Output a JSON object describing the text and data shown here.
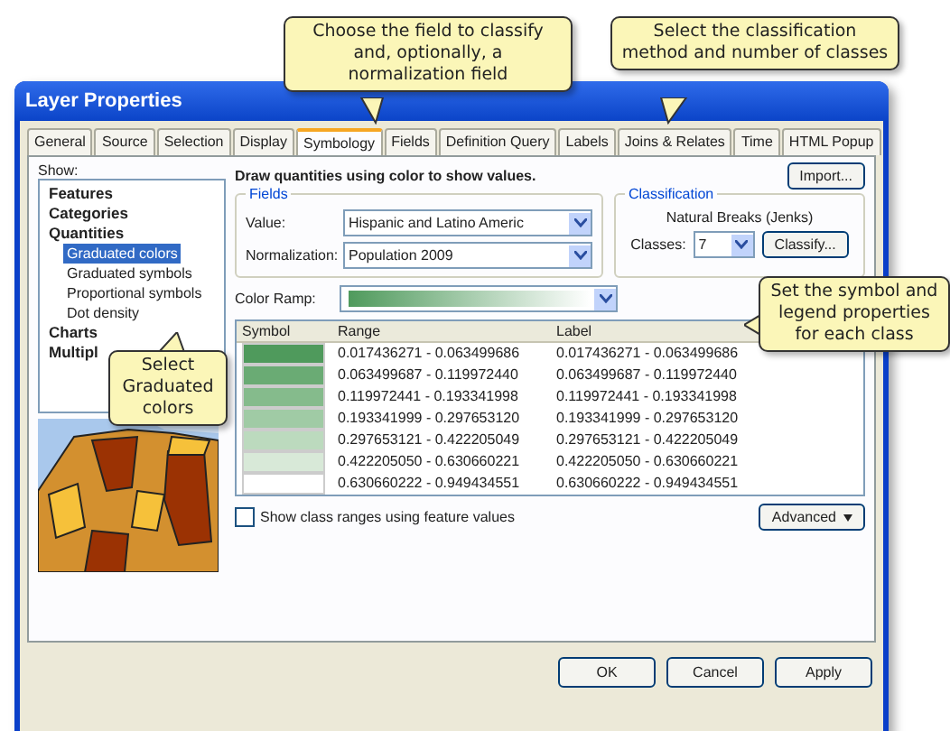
{
  "window": {
    "title": "Layer Properties"
  },
  "tabs": [
    {
      "label": "General",
      "selected": false
    },
    {
      "label": "Source",
      "selected": false
    },
    {
      "label": "Selection",
      "selected": false
    },
    {
      "label": "Display",
      "selected": false
    },
    {
      "label": "Symbology",
      "selected": true
    },
    {
      "label": "Fields",
      "selected": false
    },
    {
      "label": "Definition Query",
      "selected": false
    },
    {
      "label": "Labels",
      "selected": false
    },
    {
      "label": "Joins & Relates",
      "selected": false
    },
    {
      "label": "Time",
      "selected": false
    },
    {
      "label": "HTML Popup",
      "selected": false
    }
  ],
  "show": {
    "label": "Show:",
    "items": [
      {
        "label": "Features",
        "selected": false
      },
      {
        "label": "Categories",
        "selected": false
      },
      {
        "label": "Quantities",
        "selected": false,
        "children": [
          {
            "label": "Graduated colors",
            "selected": true
          },
          {
            "label": "Graduated symbols",
            "selected": false
          },
          {
            "label": "Proportional symbols",
            "selected": false
          },
          {
            "label": "Dot density",
            "selected": false
          }
        ]
      },
      {
        "label": "Charts",
        "selected": false
      },
      {
        "label": "Multipl",
        "selected": false
      }
    ]
  },
  "preview": {
    "kind": "picture"
  },
  "heading": "Draw quantities using color to show values.",
  "import_button": "Import...",
  "fields": {
    "legend": "Fields",
    "value_label": "Value:",
    "value": "Hispanic and Latino Americ",
    "normalization_label": "Normalization:",
    "normalization": "Population 2009"
  },
  "classification": {
    "legend": "Classification",
    "method": "Natural Breaks (Jenks)",
    "classes_label": "Classes:",
    "classes": "7",
    "classify_button": "Classify..."
  },
  "color_ramp": {
    "label": "Color Ramp:"
  },
  "table": {
    "columns": [
      "Symbol",
      "Range",
      "Label"
    ],
    "rows": [
      {
        "color": "#4f9a5c",
        "range": "0.017436271 - 0.063499686",
        "label": "0.017436271 - 0.063499686"
      },
      {
        "color": "#6aab74",
        "range": "0.063499687 - 0.119972440",
        "label": "0.063499687 - 0.119972440"
      },
      {
        "color": "#85bb8c",
        "range": "0.119972441 - 0.193341998",
        "label": "0.119972441 - 0.193341998"
      },
      {
        "color": "#a0cba5",
        "range": "0.193341999 - 0.297653120",
        "label": "0.193341999 - 0.297653120"
      },
      {
        "color": "#bcdabe",
        "range": "0.297653121 - 0.422205049",
        "label": "0.297653121 - 0.422205049"
      },
      {
        "color": "#d8e9d8",
        "range": "0.422205050 - 0.630660221",
        "label": "0.422205050 - 0.630660221"
      },
      {
        "color": "#ffffff",
        "range": "0.630660222 - 0.949434551",
        "label": "0.630660222 - 0.949434551"
      }
    ]
  },
  "show_ranges": {
    "label": "Show class ranges using feature values",
    "checked": false
  },
  "advanced_button": "Advanced",
  "buttons": [
    "OK",
    "Cancel",
    "Apply"
  ],
  "callouts": [
    "Choose the field to classify and, optionally, a normalization field",
    "Select the classification method and number of classes",
    "Set the symbol and legend properties for each class",
    "Select Graduated colors"
  ]
}
